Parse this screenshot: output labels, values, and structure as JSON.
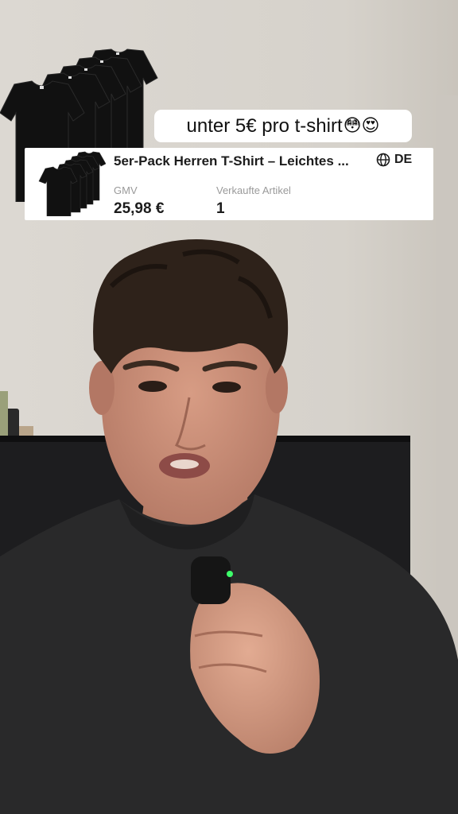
{
  "caption": {
    "text": "unter 5€ pro t-shirt",
    "emojis": "😳😍"
  },
  "product": {
    "title": "5er-Pack Herren T-Shirt – Leichtes ...",
    "region_icon": "globe-icon",
    "region_code": "DE",
    "gmv_label": "GMV",
    "gmv_value": "25,98 €",
    "sold_label": "Verkaufte Artikel",
    "sold_value": "1"
  },
  "overlay_graphics": {
    "shirt_stack_icon": "tshirt-stack-icon",
    "shirt_color": "#111111"
  },
  "scene_colors": {
    "wall": "#d9d6d0",
    "shirt": "#272727",
    "hair": "#2e221a",
    "skin": "#c08a74"
  }
}
